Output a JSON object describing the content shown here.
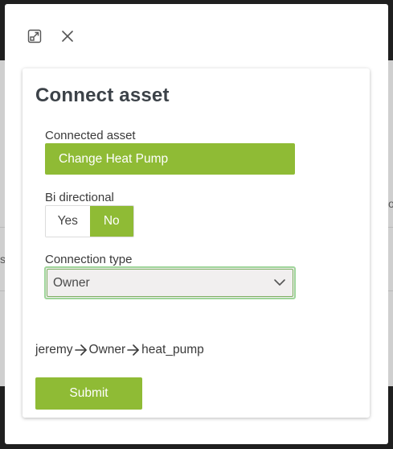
{
  "modal": {
    "expand_icon": "expand-icon",
    "close_icon": "close-icon"
  },
  "card": {
    "title": "Connect asset",
    "connected_asset": {
      "label": "Connected asset",
      "value": "Change Heat Pump"
    },
    "bi_directional": {
      "label": "Bi directional",
      "options": [
        "Yes",
        "No"
      ],
      "selected": "No"
    },
    "connection_type": {
      "label": "Connection type",
      "selected": "Owner"
    },
    "relation_path": {
      "from": "jeremy",
      "via": "Owner",
      "to": "heat_pump"
    },
    "submit_label": "Submit"
  },
  "colors": {
    "accent": "#8fbb35",
    "focus_ring": "#9fd59a",
    "title": "#3c4248"
  }
}
